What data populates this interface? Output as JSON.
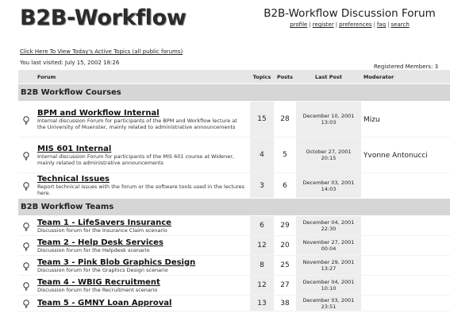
{
  "header": {
    "logo": "B2B-Workflow",
    "forum_title": "B2B-Workflow Discussion Forum",
    "nav": [
      "profile",
      "register",
      "preferences",
      "faq",
      "search"
    ]
  },
  "active_topics_link": "Click Here To View Today's Active Topics (all public forums)",
  "last_visited": "You last visited: July 15, 2002 18:26",
  "registered_members": "Registered Members: 3",
  "columns": [
    "Forum",
    "Topics",
    "Posts",
    "Last Post",
    "Moderator"
  ],
  "categories": [
    {
      "name": "B2B Workflow Courses",
      "forums": [
        {
          "name": "BPM and Workflow Internal",
          "desc": "Internal discussion Forum for participants of the BPM and Workflow lecture at the University of Muenster, mainly related to administrative announcements",
          "topics": "15",
          "posts": "28",
          "last_post_date": "December 10, 2001",
          "last_post_time": "13:03",
          "moderator": "Mizu"
        },
        {
          "name": "MIS 601 Internal",
          "desc": "Internal discussion Forum for participants of the MIS 601 course at Widener, mainly related to administrative announcements",
          "topics": "4",
          "posts": "5",
          "last_post_date": "October 27, 2001",
          "last_post_time": "20:15",
          "moderator": "Yvonne Antonucci"
        },
        {
          "name": "Technical Issues",
          "desc": "Report technical issues with the forum or the software tools used in the lectures here.",
          "topics": "3",
          "posts": "6",
          "last_post_date": "December 03, 2001",
          "last_post_time": "14:03",
          "moderator": ""
        }
      ]
    },
    {
      "name": "B2B Workflow Teams",
      "forums": [
        {
          "name": "Team 1 - LifeSavers Insurance",
          "desc": "Discussion forum for the Insurance Claim scenario",
          "topics": "6",
          "posts": "29",
          "last_post_date": "December 04, 2001",
          "last_post_time": "22:30",
          "moderator": ""
        },
        {
          "name": "Team 2 - Help Desk Services",
          "desc": "Discussion forum for the Helpdesk scenario",
          "topics": "12",
          "posts": "20",
          "last_post_date": "November 27, 2001",
          "last_post_time": "00:04",
          "moderator": ""
        },
        {
          "name": "Team 3 - Pink Blob Graphics Design",
          "desc": "Discussion forum for the Graphics Design scenario",
          "topics": "8",
          "posts": "25",
          "last_post_date": "November 29, 2001",
          "last_post_time": "13:27",
          "moderator": ""
        },
        {
          "name": "Team 4 - WBIG Recruitment",
          "desc": "Discussion forum for the Recruitment scenario",
          "topics": "12",
          "posts": "27",
          "last_post_date": "December 04, 2001",
          "last_post_time": "10:10",
          "moderator": ""
        },
        {
          "name": "Team 5 - GMNY Loan Approval",
          "desc": "",
          "topics": "13",
          "posts": "38",
          "last_post_date": "December 03, 2001",
          "last_post_time": "23:51",
          "moderator": ""
        }
      ]
    }
  ]
}
